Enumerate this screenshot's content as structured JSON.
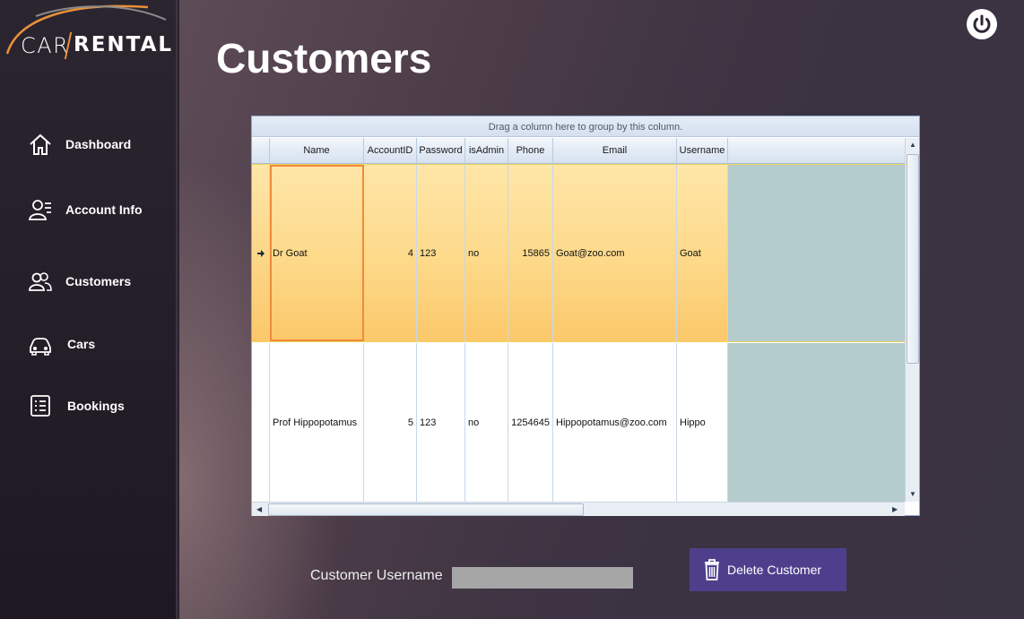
{
  "app": {
    "logo_part1": "CAR",
    "logo_part2": "RENTAL"
  },
  "sidebar": {
    "items": [
      {
        "label": "Dashboard",
        "icon": "home-icon"
      },
      {
        "label": "Account Info",
        "icon": "account-info-icon"
      },
      {
        "label": "Customers",
        "icon": "customers-icon"
      },
      {
        "label": "Cars",
        "icon": "car-icon"
      },
      {
        "label": "Bookings",
        "icon": "bookings-icon"
      }
    ]
  },
  "page": {
    "title": "Customers",
    "power_icon": "power-icon"
  },
  "grid": {
    "group_hint": "Drag a column here to group by this column.",
    "columns": [
      "Name",
      "AccountID",
      "Password",
      "isAdmin",
      "Phone",
      "Email",
      "Username"
    ],
    "rows": [
      {
        "name": "Dr Goat",
        "account_id": "4",
        "password": "123",
        "is_admin": "no",
        "phone": "15865",
        "email": "Goat@zoo.com",
        "username": "Goat",
        "selected": true
      },
      {
        "name": "Prof Hippopotamus",
        "account_id": "5",
        "password": "123",
        "is_admin": "no",
        "phone": "1254645",
        "email": "Hippopotamus@zoo.com",
        "username": "Hippo",
        "selected": false
      }
    ]
  },
  "footer": {
    "customer_username_label": "Customer Username",
    "customer_username_value": "",
    "delete_button_label": "Delete Customer",
    "delete_icon": "trash-icon"
  },
  "colors": {
    "accent_orange": "#e8913a",
    "selected_row": "#fdd989",
    "button_purple": "#4e3f8d"
  }
}
